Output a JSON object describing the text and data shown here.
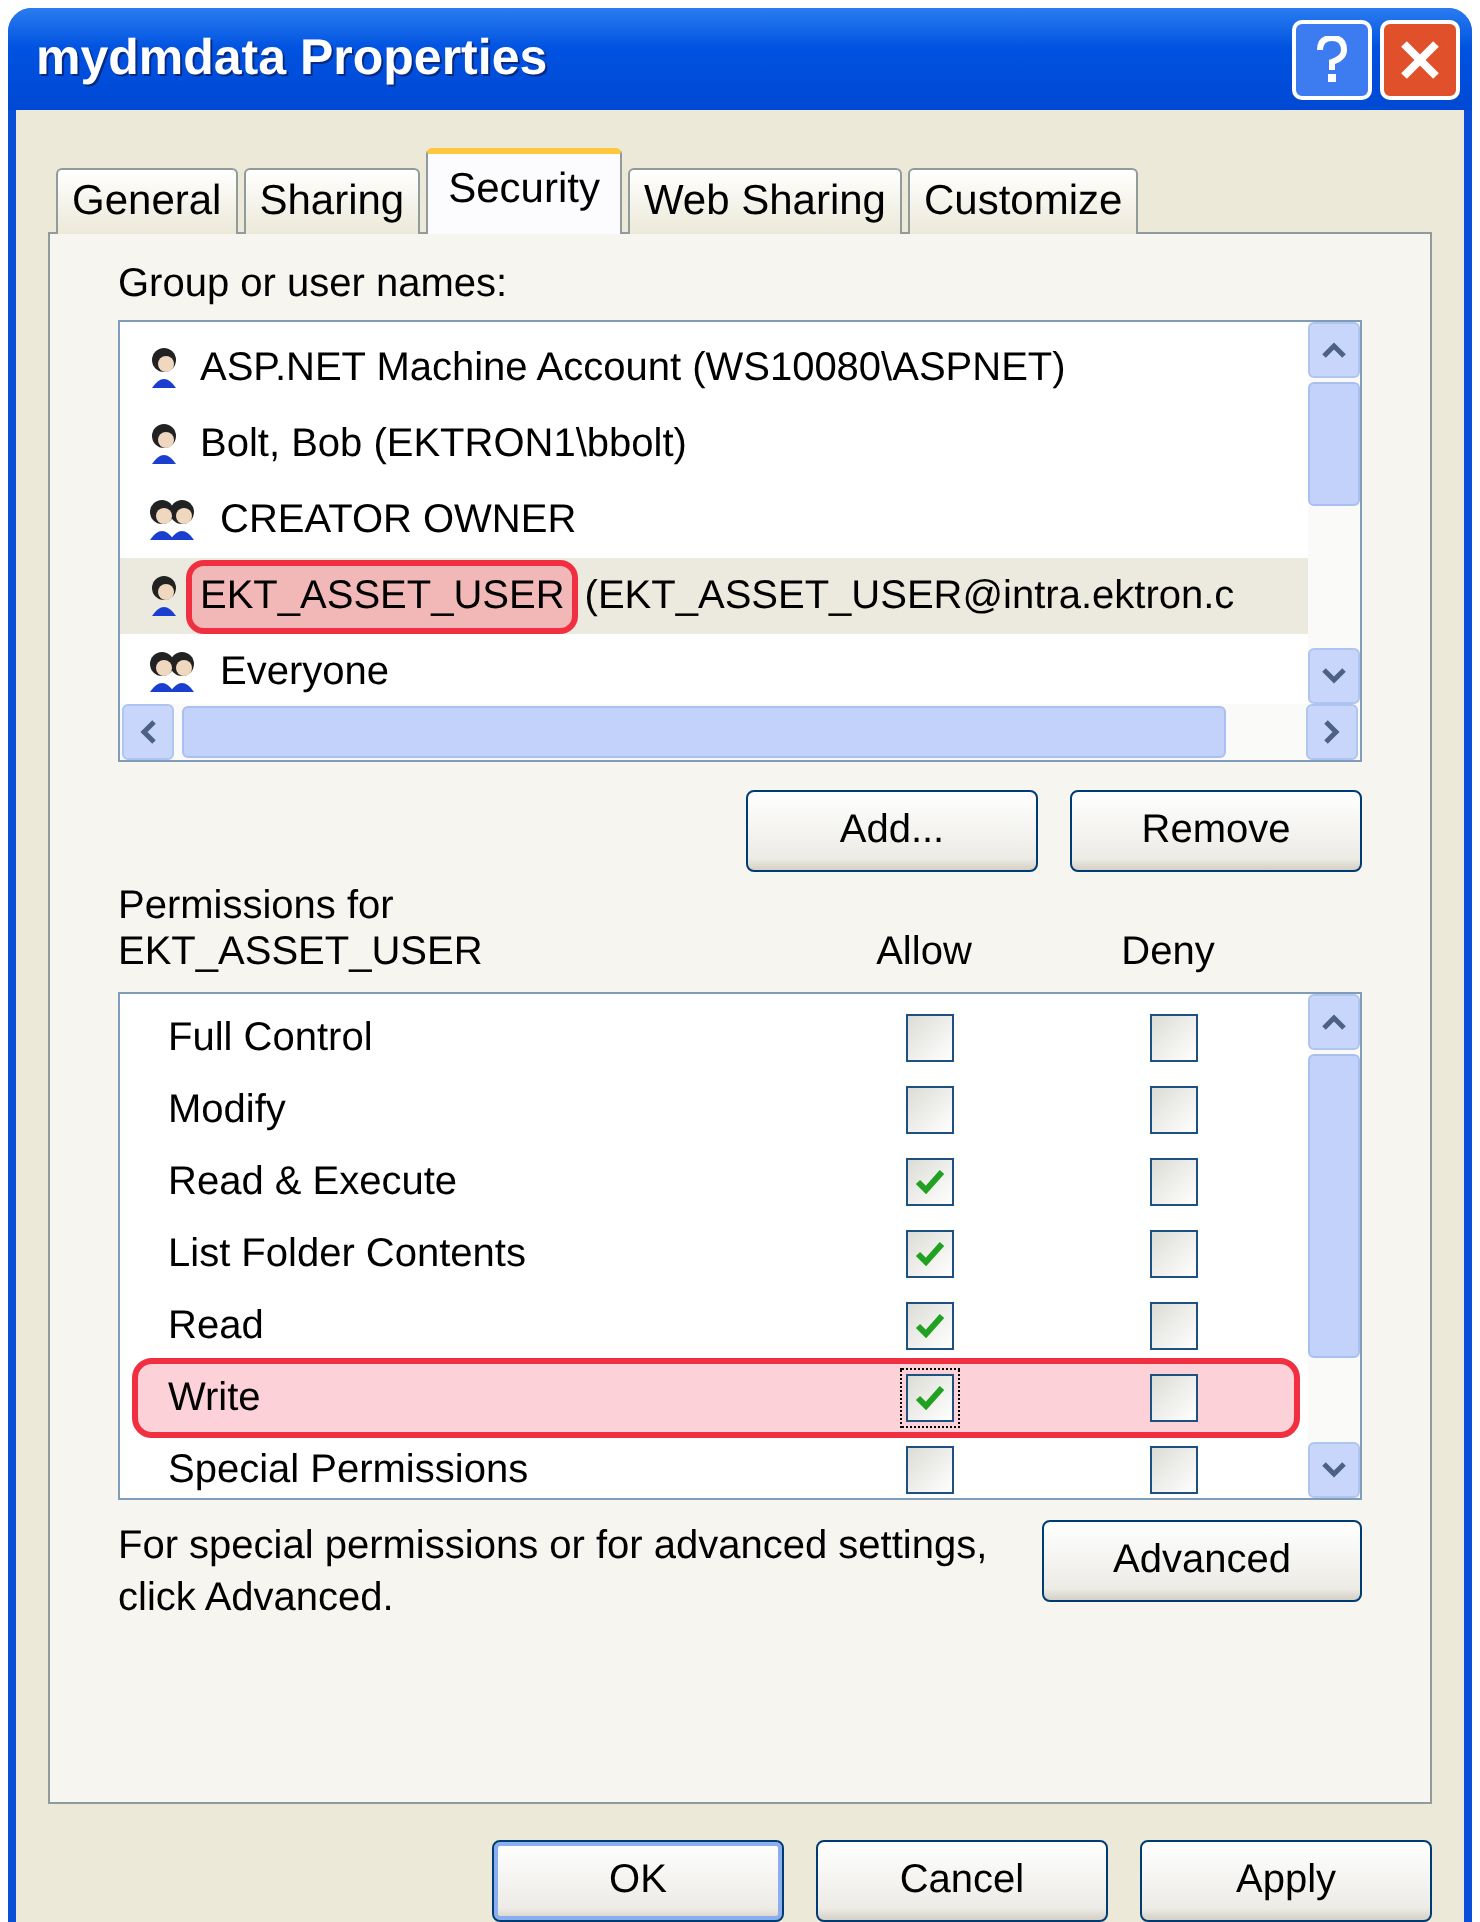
{
  "window": {
    "title": "mydmdata Properties"
  },
  "tabs": [
    {
      "label": "General",
      "selected": false
    },
    {
      "label": "Sharing",
      "selected": false
    },
    {
      "label": "Security",
      "selected": true
    },
    {
      "label": "Web Sharing",
      "selected": false
    },
    {
      "label": "Customize",
      "selected": false
    }
  ],
  "users": {
    "label": "Group or user names:",
    "items": [
      {
        "kind": "user",
        "name": "ASP.NET Machine Account (WS10080\\ASPNET)",
        "selected": false,
        "annotated": false
      },
      {
        "kind": "user",
        "name": "Bolt, Bob (EKTRON1\\bbolt)",
        "selected": false,
        "annotated": false
      },
      {
        "kind": "group",
        "name": "CREATOR OWNER",
        "selected": false,
        "annotated": false
      },
      {
        "kind": "user",
        "name": "EKT_ASSET_USER",
        "detail": "(EKT_ASSET_USER@intra.ektron.c",
        "selected": true,
        "annotated": true
      },
      {
        "kind": "group",
        "name": "Everyone",
        "selected": false,
        "annotated": false
      }
    ]
  },
  "user_buttons": [
    "Add...",
    "Remove"
  ],
  "permissions": {
    "label": "Permissions for",
    "user": "EKT_ASSET_USER",
    "allow_header": "Allow",
    "deny_header": "Deny",
    "items": [
      {
        "name": "Full Control",
        "allow": false,
        "deny": false,
        "annotated": false
      },
      {
        "name": "Modify",
        "allow": false,
        "deny": false,
        "annotated": false
      },
      {
        "name": "Read & Execute",
        "allow": true,
        "deny": false,
        "annotated": false
      },
      {
        "name": "List Folder Contents",
        "allow": true,
        "deny": false,
        "annotated": false
      },
      {
        "name": "Read",
        "allow": true,
        "deny": false,
        "annotated": false
      },
      {
        "name": "Write",
        "allow": true,
        "deny": false,
        "annotated": true
      },
      {
        "name": "Special Permissions",
        "allow": false,
        "deny": false,
        "annotated": false
      }
    ]
  },
  "advanced": {
    "text": "For special permissions or for advanced settings, click Advanced.",
    "button": "Advanced"
  },
  "buttons": [
    "OK",
    "Cancel",
    "Apply"
  ]
}
